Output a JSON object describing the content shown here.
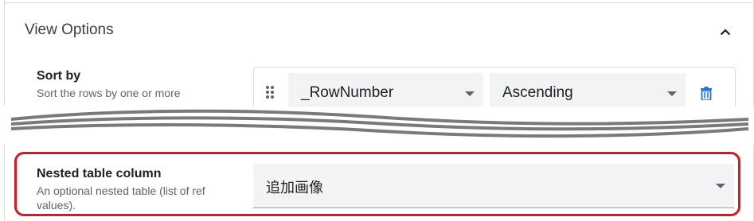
{
  "view_options": {
    "title": "View Options",
    "collapse_icon": "chevron-up-icon"
  },
  "sort_by": {
    "title": "Sort by",
    "description": "Sort the rows by one or more",
    "column_value": "_RowNumber",
    "order_value": "Ascending",
    "drag_icon": "drag-handle-icon",
    "delete_icon": "trash-icon"
  },
  "nested_table_column": {
    "title": "Nested table column",
    "description_line1": "An optional nested table (list of ref",
    "description_line2": "values).",
    "value": "追加画像"
  },
  "colors": {
    "accent": "#1a73e8",
    "highlight": "#e0141e",
    "field_bg": "#f1f3f4",
    "border": "#dadce0"
  }
}
